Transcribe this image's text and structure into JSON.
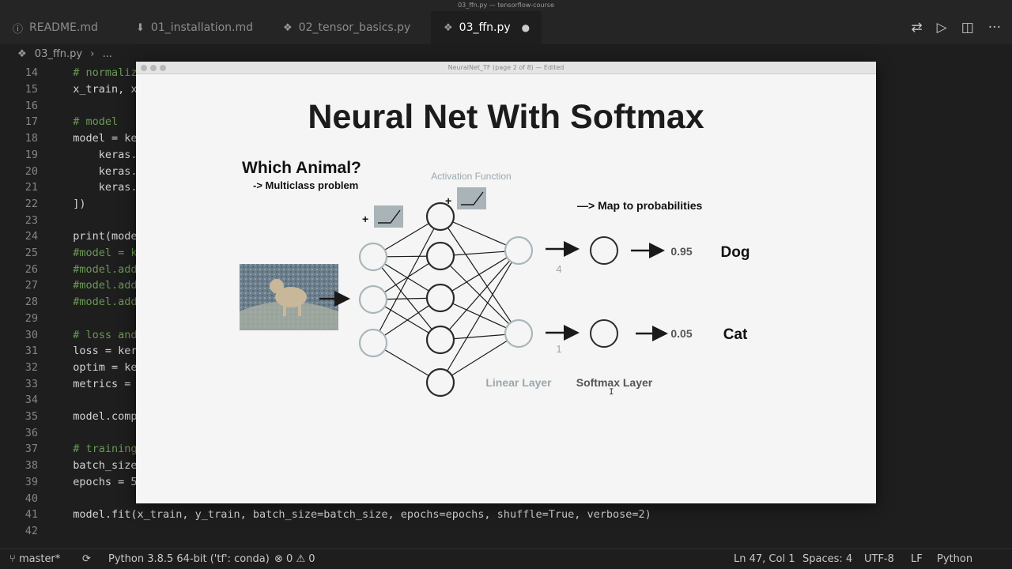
{
  "window": {
    "title": "03_ffn.py — tensorflow-course"
  },
  "tabs": [
    {
      "label": "README.md",
      "icon": "info-icon"
    },
    {
      "label": "01_installation.md",
      "icon": "download-icon"
    },
    {
      "label": "02_tensor_basics.py",
      "icon": "python-file-icon"
    },
    {
      "label": "03_ffn.py",
      "icon": "python-file-icon",
      "active": true,
      "dirty": "●"
    }
  ],
  "tab_actions": [
    "compare-icon",
    "run-icon",
    "split-editor-icon",
    "more-icon"
  ],
  "breadcrumb": {
    "file": "03_ffn.py",
    "sep": "›",
    "rest": "..."
  },
  "editor": {
    "lines": [
      {
        "n": "14",
        "text": "  # normalize",
        "cls": "comment"
      },
      {
        "n": "15",
        "text": "  x_train, x_t",
        "cls": ""
      },
      {
        "n": "16",
        "text": "",
        "cls": ""
      },
      {
        "n": "17",
        "text": "  # model",
        "cls": "comment"
      },
      {
        "n": "18",
        "text": "  model = kera",
        "cls": ""
      },
      {
        "n": "19",
        "text": "      keras.la",
        "cls": ""
      },
      {
        "n": "20",
        "text": "      keras.la",
        "cls": ""
      },
      {
        "n": "21",
        "text": "      keras.la",
        "cls": ""
      },
      {
        "n": "22",
        "text": "  ])",
        "cls": ""
      },
      {
        "n": "23",
        "text": "",
        "cls": ""
      },
      {
        "n": "24",
        "text": "  print(model.",
        "cls": ""
      },
      {
        "n": "25",
        "text": "  #model = ker",
        "cls": "comment"
      },
      {
        "n": "26",
        "text": "  #model.add(k",
        "cls": "comment"
      },
      {
        "n": "27",
        "text": "  #model.add(k",
        "cls": "comment"
      },
      {
        "n": "28",
        "text": "  #model.add(k",
        "cls": "comment"
      },
      {
        "n": "29",
        "text": "",
        "cls": ""
      },
      {
        "n": "30",
        "text": "  # loss and o",
        "cls": "comment"
      },
      {
        "n": "31",
        "text": "  loss = keras",
        "cls": ""
      },
      {
        "n": "32",
        "text": "  optim = kera",
        "cls": ""
      },
      {
        "n": "33",
        "text": "  metrics = [\"",
        "cls": ""
      },
      {
        "n": "34",
        "text": "",
        "cls": ""
      },
      {
        "n": "35",
        "text": "  model.compil",
        "cls": ""
      },
      {
        "n": "36",
        "text": "",
        "cls": ""
      },
      {
        "n": "37",
        "text": "  # training",
        "cls": "comment"
      },
      {
        "n": "38",
        "text": "  batch_size =",
        "cls": ""
      },
      {
        "n": "39",
        "text": "  epochs = 5",
        "cls": ""
      },
      {
        "n": "40",
        "text": "",
        "cls": ""
      },
      {
        "n": "41",
        "text": "  model.fit(x_train, y_train, batch_size=batch_size, epochs=epochs, shuffle=True, verbose=2)",
        "cls": ""
      },
      {
        "n": "42",
        "text": "",
        "cls": ""
      }
    ]
  },
  "slide": {
    "window_title": "NeuralNet_TF (page 2 of 8) — Edited",
    "title": "Neural Net With Softmax",
    "question": "Which Animal?",
    "problem": "-> Multiclass problem",
    "activation_label": "Activation Function",
    "plus1": "+",
    "plus2": "+",
    "map_label": "—> Map to probabilities",
    "out_top_value": "4",
    "out_bottom_value": "1",
    "prob_top": "0.95",
    "prob_bottom": "0.05",
    "class_top": "Dog",
    "class_bottom": "Cat",
    "linear_label": "Linear Layer",
    "softmax_label": "Softmax Layer",
    "image_subject": "dog-photo",
    "colors": {
      "node_light": "#a9b6ba",
      "node_dark": "#2b2b2b",
      "line": "#1a1a1a",
      "label_grey": "#9aa7ad"
    }
  },
  "status": {
    "branch": "master*",
    "sync_icon": "sync-icon",
    "interpreter": "Python 3.8.5 64-bit ('tf': conda)",
    "errors": "0",
    "warnings": "0",
    "position": "Ln 47, Col 1",
    "spaces": "Spaces: 4",
    "encoding": "UTF-8",
    "eol": "LF",
    "language": "Python"
  }
}
